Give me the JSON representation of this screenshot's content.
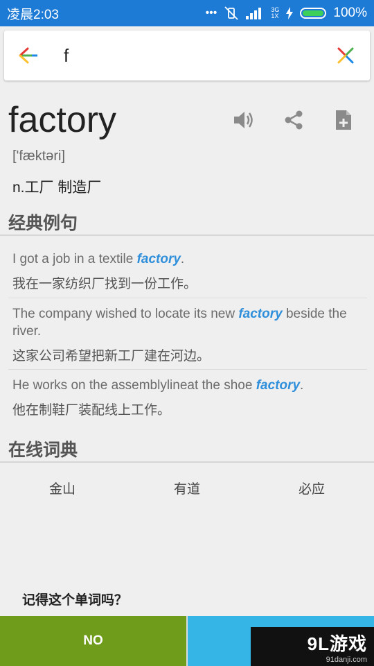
{
  "status_bar": {
    "time": "凌晨2:03",
    "network_top": "3G",
    "network_bottom": "1X",
    "battery": "100%"
  },
  "search": {
    "value": "f",
    "back_icon": "back-arrow-icon",
    "clear_icon": "close-icon"
  },
  "word": {
    "headword": "factory",
    "phonetic": "['fæktəri]",
    "meaning": "n.工厂 制造厂",
    "actions": [
      "speaker-icon",
      "share-icon",
      "add-note-icon"
    ]
  },
  "examples_section": {
    "title": "经典例句",
    "items": [
      {
        "en_before": "I got a job in a textile ",
        "en_hl": "factory",
        "en_after": ".",
        "zh": "我在一家纺织厂找到一份工作。"
      },
      {
        "en_before": "The company wished to locate its new ",
        "en_hl": "factory",
        "en_after": " beside the river.",
        "zh": "这家公司希望把新工厂建在河边。"
      },
      {
        "en_before": "He works on the assemblylineat the shoe ",
        "en_hl": "factory",
        "en_after": ".",
        "zh": "他在制鞋厂装配线上工作。"
      }
    ]
  },
  "online_section": {
    "title": "在线词典",
    "links": [
      "金山",
      "有道",
      "必应"
    ]
  },
  "review": {
    "question": "记得这个单词吗？",
    "no_label": "NO",
    "yes_label": "Y"
  },
  "watermark": {
    "logo": "9L游戏",
    "site": "91danji.com"
  },
  "colors": {
    "status_bar": "#1d7bd6",
    "highlight": "#2f8fda",
    "no_button": "#6f9c1a",
    "yes_button": "#35b4e6"
  }
}
